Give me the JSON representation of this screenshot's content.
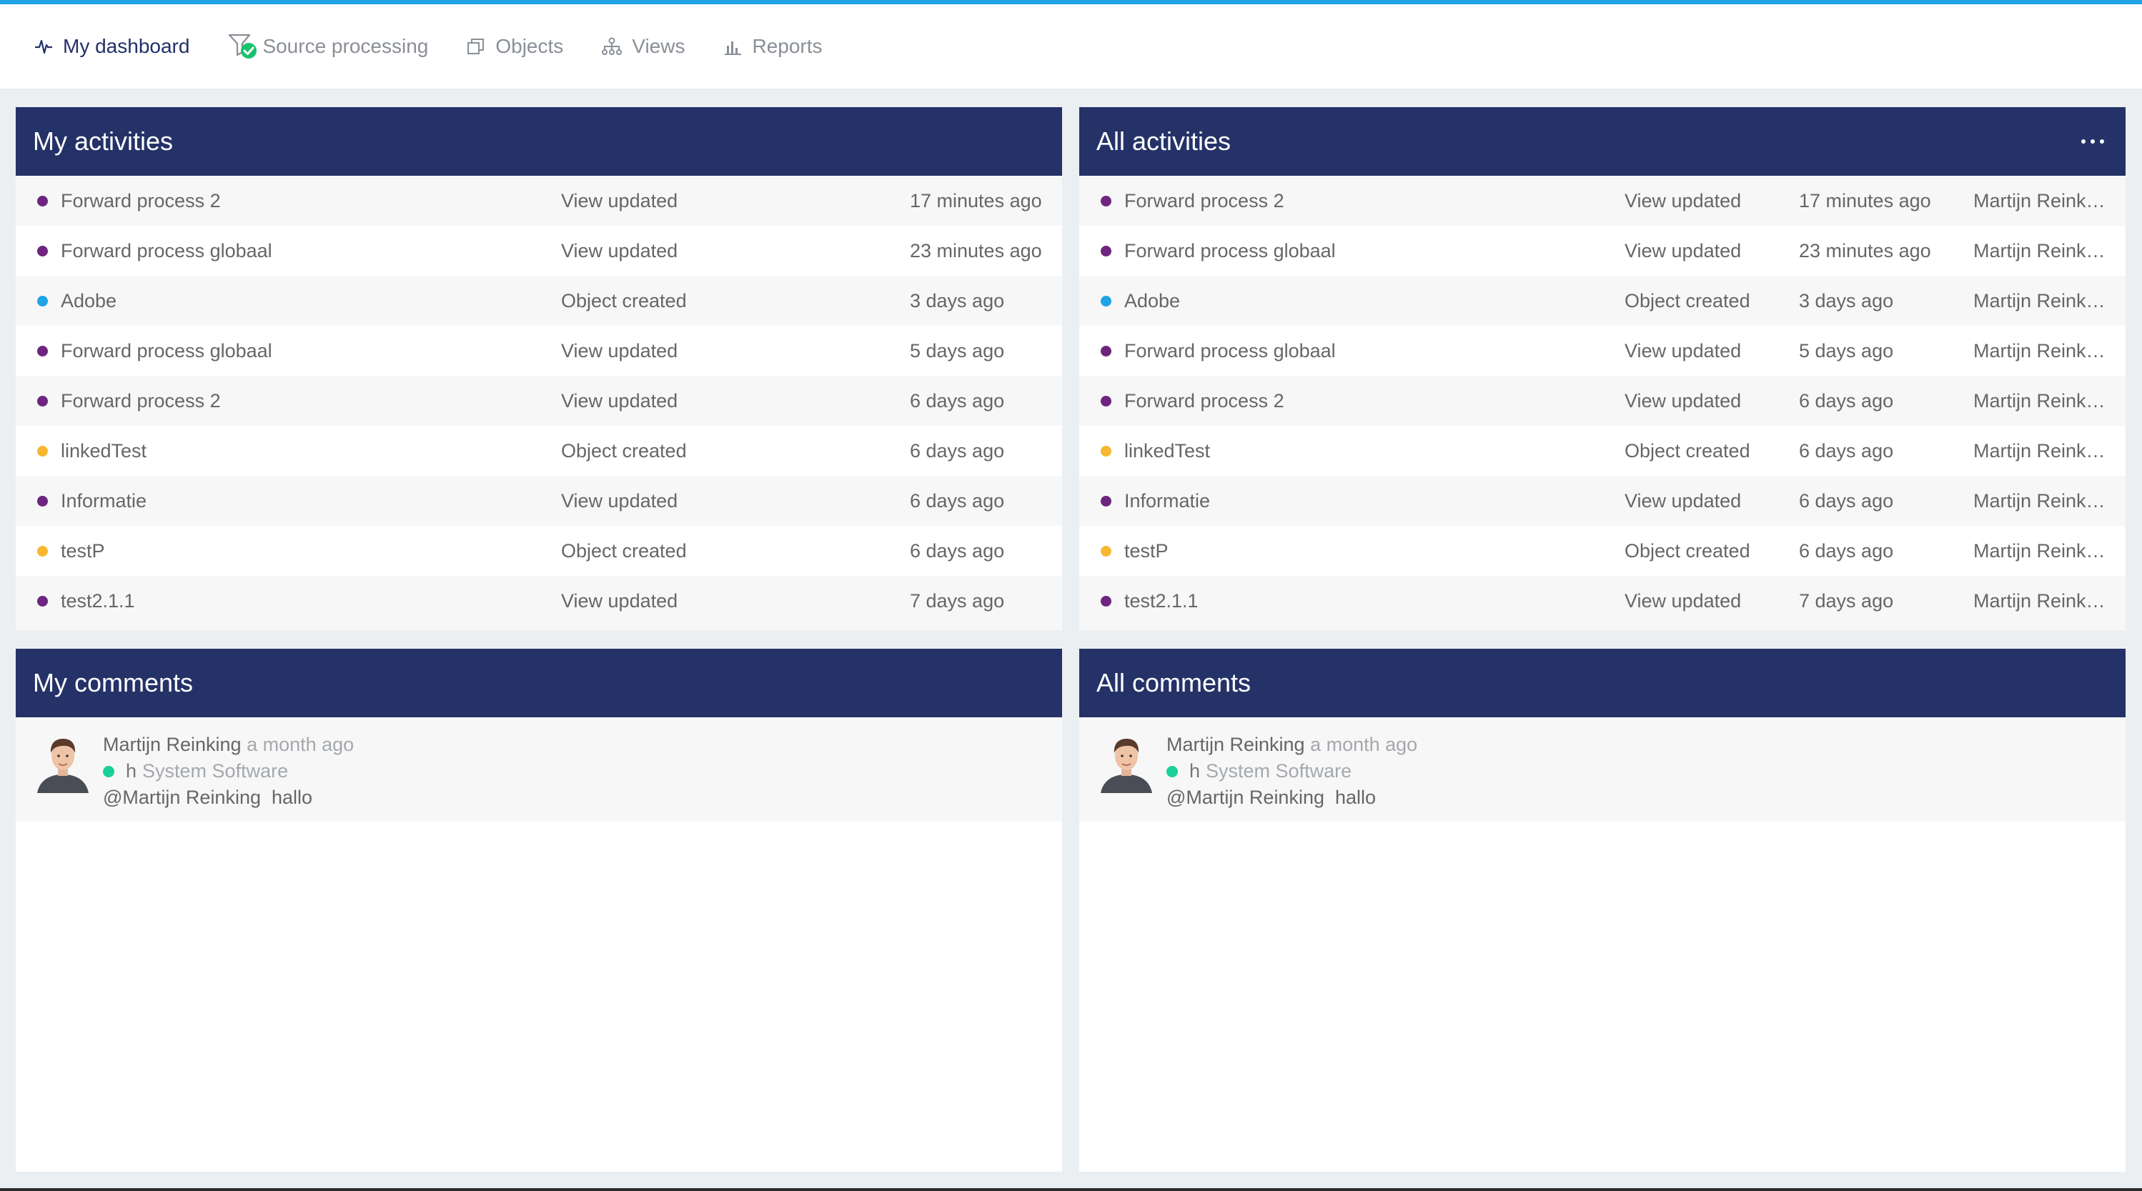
{
  "nav": {
    "items": [
      {
        "label": "My dashboard",
        "icon": "pulse-icon",
        "active": true
      },
      {
        "label": "Source processing",
        "icon": "filter-check-icon",
        "active": false
      },
      {
        "label": "Objects",
        "icon": "stacked-squares-icon",
        "active": false
      },
      {
        "label": "Views",
        "icon": "hierarchy-icon",
        "active": false
      },
      {
        "label": "Reports",
        "icon": "bar-chart-icon",
        "active": false
      }
    ]
  },
  "colors": {
    "accent_line": "#1fa3e6",
    "header_bg": "#243268",
    "view_dot": "#6d2580",
    "object_dot_blue": "#1fa3e6",
    "object_dot_yellow": "#f7b731",
    "context_dot": "#19cf9a"
  },
  "my_activities": {
    "title": "My activities",
    "rows": [
      {
        "name": "Forward process 2",
        "action": "View updated",
        "time": "17 minutes ago",
        "dot": "#6d2580"
      },
      {
        "name": "Forward process globaal",
        "action": "View updated",
        "time": "23 minutes ago",
        "dot": "#6d2580"
      },
      {
        "name": "Adobe",
        "action": "Object created",
        "time": "3 days ago",
        "dot": "#1fa3e6"
      },
      {
        "name": "Forward process globaal",
        "action": "View updated",
        "time": "5 days ago",
        "dot": "#6d2580"
      },
      {
        "name": "Forward process 2",
        "action": "View updated",
        "time": "6 days ago",
        "dot": "#6d2580"
      },
      {
        "name": "linkedTest",
        "action": "Object created",
        "time": "6 days ago",
        "dot": "#f7b731"
      },
      {
        "name": "Informatie",
        "action": "View updated",
        "time": "6 days ago",
        "dot": "#6d2580"
      },
      {
        "name": "testP",
        "action": "Object created",
        "time": "6 days ago",
        "dot": "#f7b731"
      },
      {
        "name": "test2.1.1",
        "action": "View updated",
        "time": "7 days ago",
        "dot": "#6d2580"
      }
    ]
  },
  "all_activities": {
    "title": "All activities",
    "rows": [
      {
        "name": "Forward process 2",
        "action": "View updated",
        "time": "17 minutes ago",
        "user": "Martijn Reinking",
        "dot": "#6d2580"
      },
      {
        "name": "Forward process globaal",
        "action": "View updated",
        "time": "23 minutes ago",
        "user": "Martijn Reinking",
        "dot": "#6d2580"
      },
      {
        "name": "Adobe",
        "action": "Object created",
        "time": "3 days ago",
        "user": "Martijn Reinking",
        "dot": "#1fa3e6"
      },
      {
        "name": "Forward process globaal",
        "action": "View updated",
        "time": "5 days ago",
        "user": "Martijn Reinking",
        "dot": "#6d2580"
      },
      {
        "name": "Forward process 2",
        "action": "View updated",
        "time": "6 days ago",
        "user": "Martijn Reinking",
        "dot": "#6d2580"
      },
      {
        "name": "linkedTest",
        "action": "Object created",
        "time": "6 days ago",
        "user": "Martijn Reinking",
        "dot": "#f7b731"
      },
      {
        "name": "Informatie",
        "action": "View updated",
        "time": "6 days ago",
        "user": "Martijn Reinking",
        "dot": "#6d2580"
      },
      {
        "name": "testP",
        "action": "Object created",
        "time": "6 days ago",
        "user": "Martijn Reinking",
        "dot": "#f7b731"
      },
      {
        "name": "test2.1.1",
        "action": "View updated",
        "time": "7 days ago",
        "user": "Martijn Reinking",
        "dot": "#6d2580"
      }
    ]
  },
  "my_comments": {
    "title": "My comments",
    "items": [
      {
        "author": "Martijn Reinking",
        "time": "a month ago",
        "context_prefix": "h",
        "context": "System Software",
        "text": "@Martijn Reinking  hallo"
      }
    ]
  },
  "all_comments": {
    "title": "All comments",
    "items": [
      {
        "author": "Martijn Reinking",
        "time": "a month ago",
        "context_prefix": "h",
        "context": "System Software",
        "text": "@Martijn Reinking  hallo"
      }
    ]
  }
}
